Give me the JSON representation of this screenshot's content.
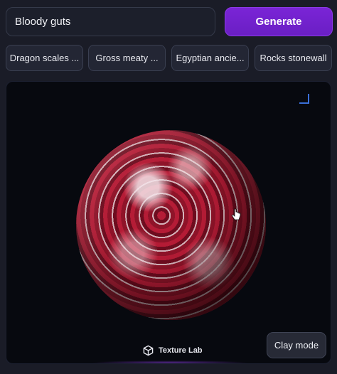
{
  "prompt": {
    "value": "Bloody guts",
    "generate_label": "Generate"
  },
  "presets": [
    {
      "label": "Dragon scales ..."
    },
    {
      "label": "Gross meaty ..."
    },
    {
      "label": "Egyptian ancie..."
    },
    {
      "label": "Rocks stonewall"
    }
  ],
  "viewer": {
    "brand_name": "Texture Lab",
    "clay_mode_label": "Clay mode"
  },
  "colors": {
    "accent": "#7a24d6",
    "background": "#1a1c27",
    "viewer_bg": "#07090f"
  }
}
